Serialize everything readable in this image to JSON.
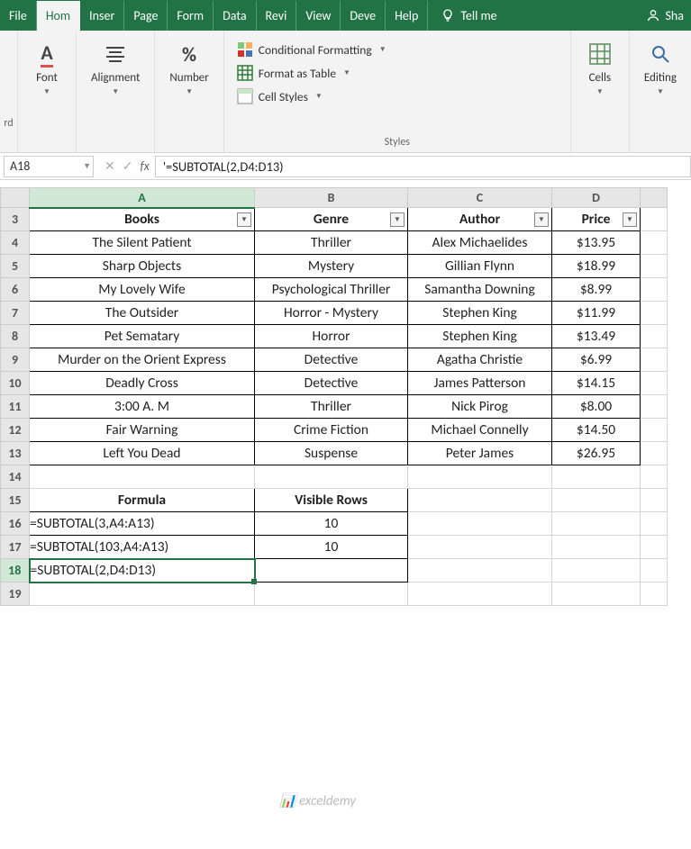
{
  "tabs": [
    "File",
    "Hom",
    "Inser",
    "Page",
    "Form",
    "Data",
    "Revi",
    "View",
    "Deve",
    "Help"
  ],
  "active_tab": 1,
  "tellme": "Tell me",
  "share": "Sha",
  "ribbon": {
    "clipboard_cut": "rd",
    "font": "Font",
    "alignment": "Alignment",
    "number": "Number",
    "cond_fmt": "Conditional Formatting",
    "fmt_table": "Format as Table",
    "cell_styles": "Cell Styles",
    "styles": "Styles",
    "cells": "Cells",
    "editing": "Editing"
  },
  "name_box": "A18",
  "formula": "'=SUBTOTAL(2,D4:D13)",
  "cols": [
    "A",
    "B",
    "C",
    "D"
  ],
  "headers": {
    "a": "Books",
    "b": "Genre",
    "c": "Author",
    "d": "Price"
  },
  "chart_data": {
    "type": "table",
    "columns": [
      "Books",
      "Genre",
      "Author",
      "Price"
    ],
    "rows": [
      {
        "book": "The Silent Patient",
        "genre": "Thriller",
        "author": "Alex Michaelides",
        "price": "$13.95"
      },
      {
        "book": "Sharp Objects",
        "genre": "Mystery",
        "author": "Gillian Flynn",
        "price": "$18.99"
      },
      {
        "book": "My Lovely Wife",
        "genre": "Psychological Thriller",
        "author": "Samantha Downing",
        "price": "$8.99"
      },
      {
        "book": "The Outsider",
        "genre": "Horror - Mystery",
        "author": "Stephen King",
        "price": "$11.99"
      },
      {
        "book": "Pet Sematary",
        "genre": "Horror",
        "author": "Stephen King",
        "price": "$13.49"
      },
      {
        "book": "Murder on the Orient Express",
        "genre": "Detective",
        "author": "Agatha Christie",
        "price": "$6.99"
      },
      {
        "book": "Deadly Cross",
        "genre": "Detective",
        "author": "James Patterson",
        "price": "$14.15"
      },
      {
        "book": "3:00 A. M",
        "genre": "Thriller",
        "author": "Nick Pirog",
        "price": "$8.00"
      },
      {
        "book": "Fair Warning",
        "genre": "Crime Fiction",
        "author": "Michael Connelly",
        "price": "$14.50"
      },
      {
        "book": "Left You Dead",
        "genre": "Suspense",
        "author": "Peter James",
        "price": "$26.95"
      }
    ],
    "formula_section": {
      "header_a": "Formula",
      "header_b": "Visible Rows",
      "rows": [
        {
          "formula": "=SUBTOTAL(3,A4:A13)",
          "result": "10"
        },
        {
          "formula": "=SUBTOTAL(103,A4:A13)",
          "result": "10"
        },
        {
          "formula": "=SUBTOTAL(2,D4:D13)",
          "result": ""
        }
      ]
    }
  },
  "watermark": "exceldemy",
  "row_tall": {
    "4": true,
    "6": true,
    "9": true,
    "10": true,
    "12": true
  }
}
